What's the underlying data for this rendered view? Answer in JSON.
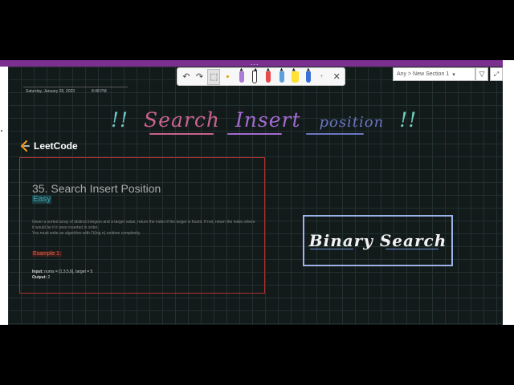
{
  "header": {
    "dots": "..."
  },
  "page": {
    "date": "Saturday, January 28, 2023",
    "time": "8:48 PM"
  },
  "section_selector": {
    "label": "Any > New Section 1"
  },
  "toolbar": {
    "tools": [
      "undo-icon",
      "redo-icon",
      "select-icon",
      "lasso-dot",
      "pen",
      "pen",
      "pen",
      "pen",
      "highlighter",
      "pen",
      "close-icon"
    ],
    "pen_colors": [
      "#a97ad6",
      "#ffffff",
      "#e84a4a",
      "#5aa0e0",
      "#ffe033",
      "#3a6fd8"
    ]
  },
  "ink": {
    "title_parts": [
      "!!",
      "Search",
      "Insert",
      "position",
      "!!"
    ],
    "title_colors": [
      "#6fc4c6",
      "#c9638f",
      "#a46bd0",
      "#6a77c4",
      "#6fd1bf"
    ],
    "binary_search": "Binary Search"
  },
  "logo": {
    "text": "LeetCode"
  },
  "problem": {
    "title": "35. Search Insert Position",
    "difficulty": "Easy",
    "description_1": "Given a sorted array of distinct integers and a target value, return the index if the target is found. If not, return the index where it would be if it were inserted in order.",
    "description_2": "You must write an algorithm with O(log n) runtime complexity.",
    "example_label": "Example 1:",
    "input_label": "Input:",
    "input_value": "nums = [1,3,5,6], target = 5",
    "output_label": "Output:",
    "output_value": "2"
  }
}
